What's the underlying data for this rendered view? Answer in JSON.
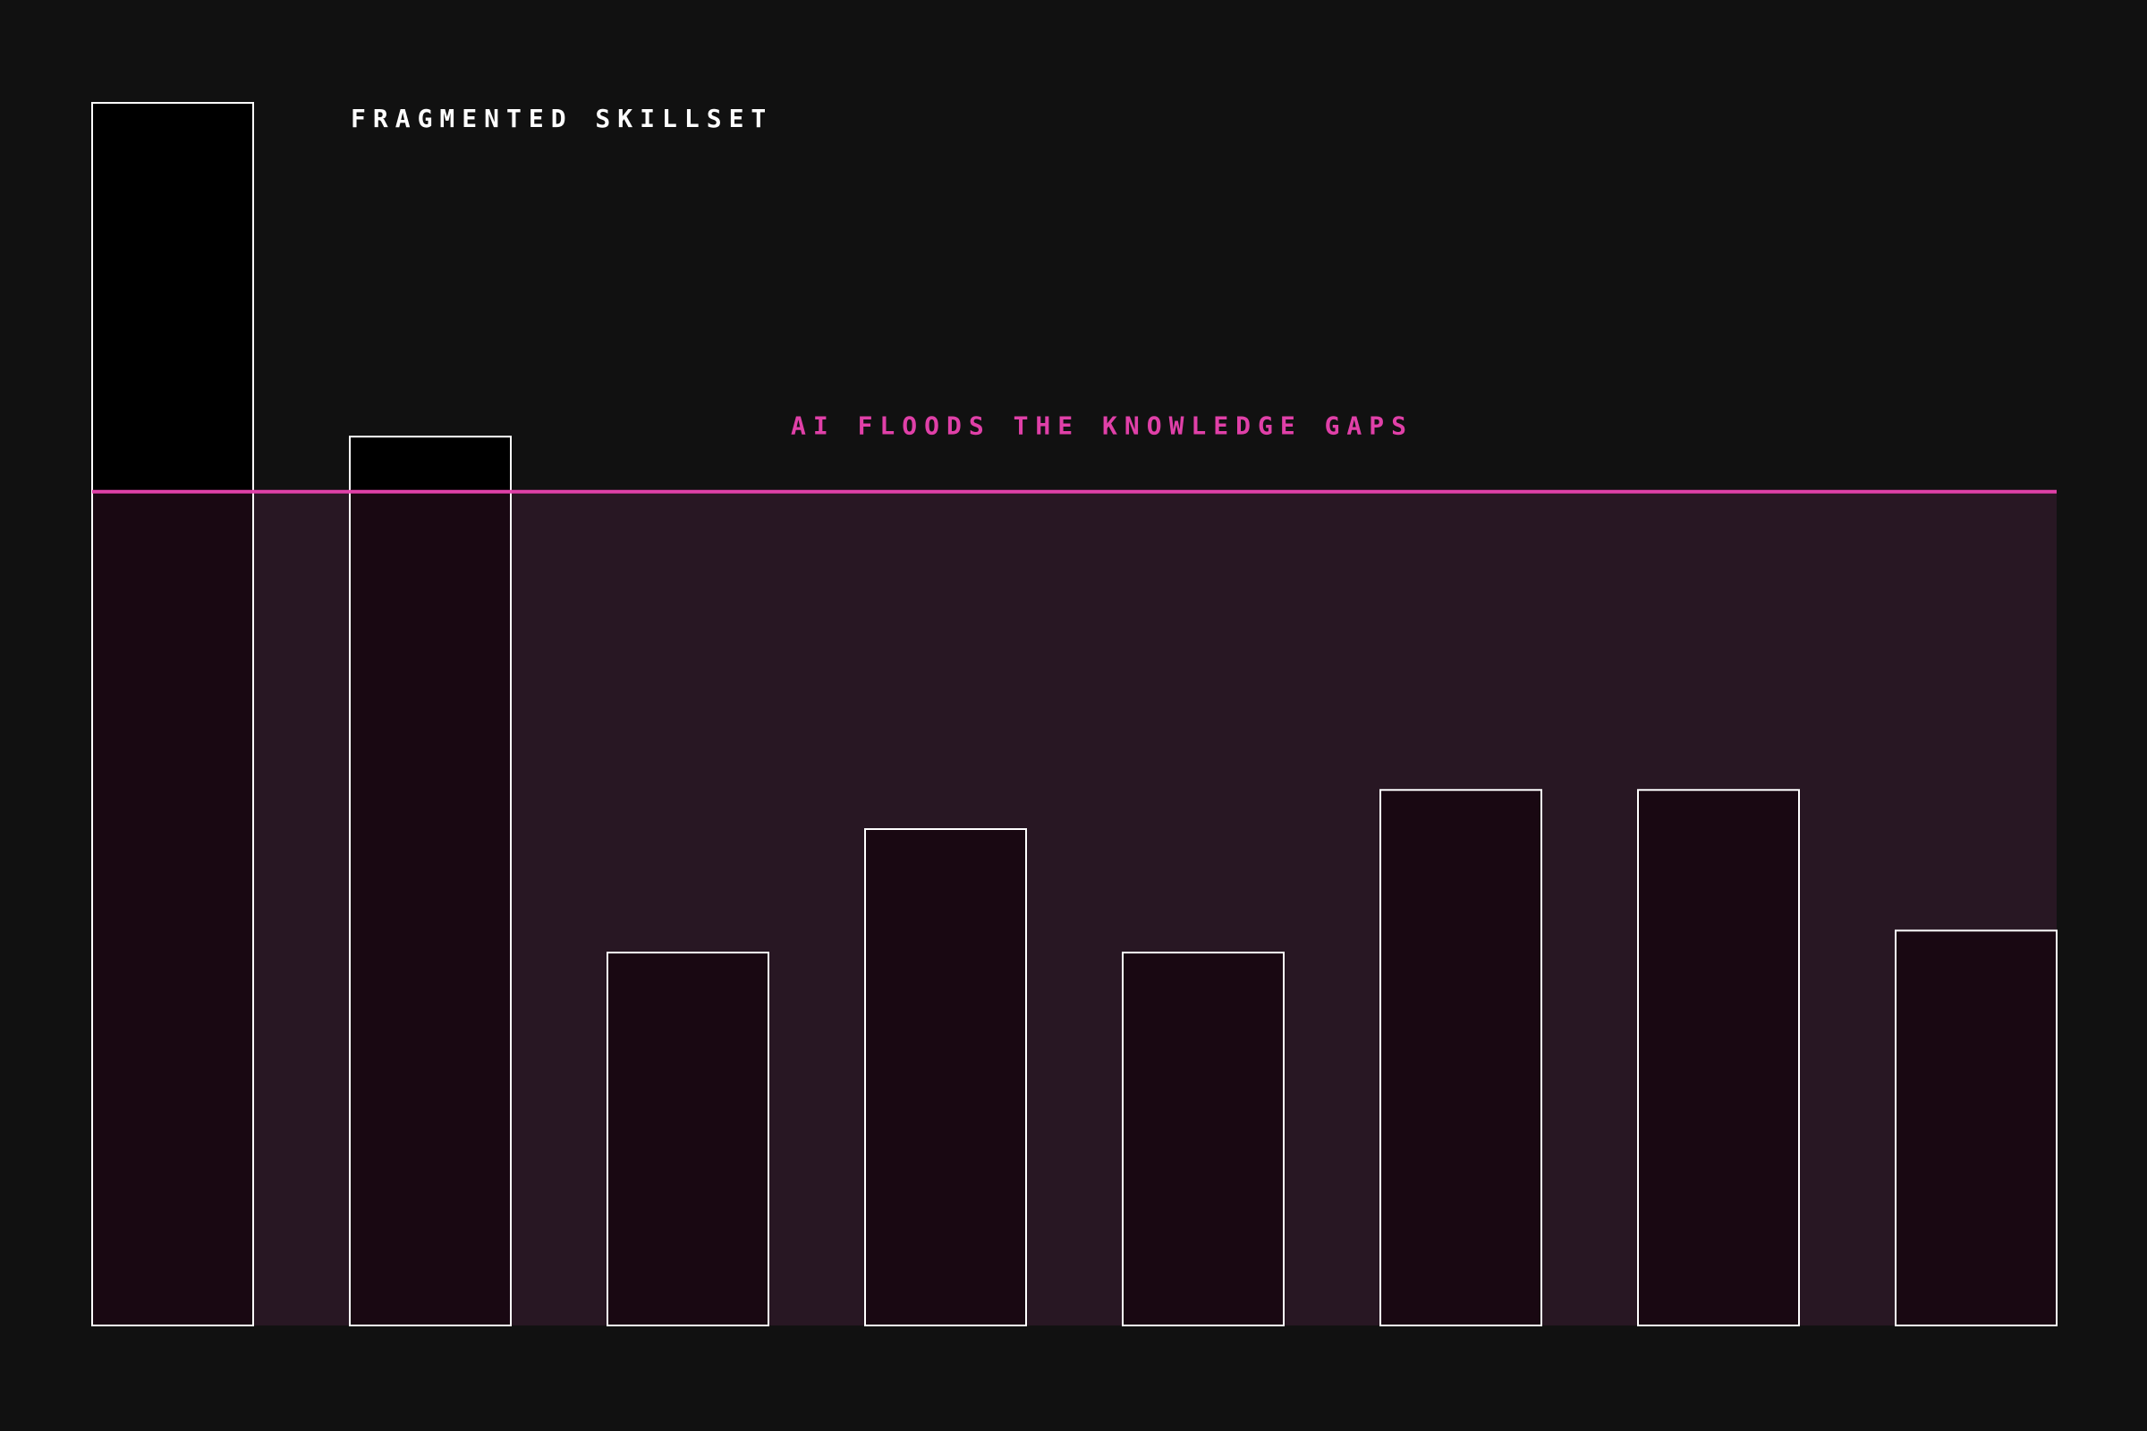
{
  "chart_data": {
    "type": "bar",
    "title": "FRAGMENTED SKILLSET",
    "categories": [],
    "values": [
      100,
      72.7,
      30.5,
      40.6,
      30.5,
      43.8,
      43.8,
      32.3
    ],
    "ylim": [
      0,
      100
    ],
    "grid": false,
    "annotations": [
      {
        "text": "AI FLOODS THE KNOWLEDGE GAPS",
        "threshold": 68.2
      }
    ]
  },
  "colors": {
    "background": "#111111",
    "bar_fill_above": "#000000",
    "bar_fill_below": "#190812",
    "bar_stroke": "#ffffff",
    "flood_fill": "#281723",
    "flood_line": "#e040a8",
    "annotation_text": "#e040a8",
    "title_text": "#ffffff"
  }
}
